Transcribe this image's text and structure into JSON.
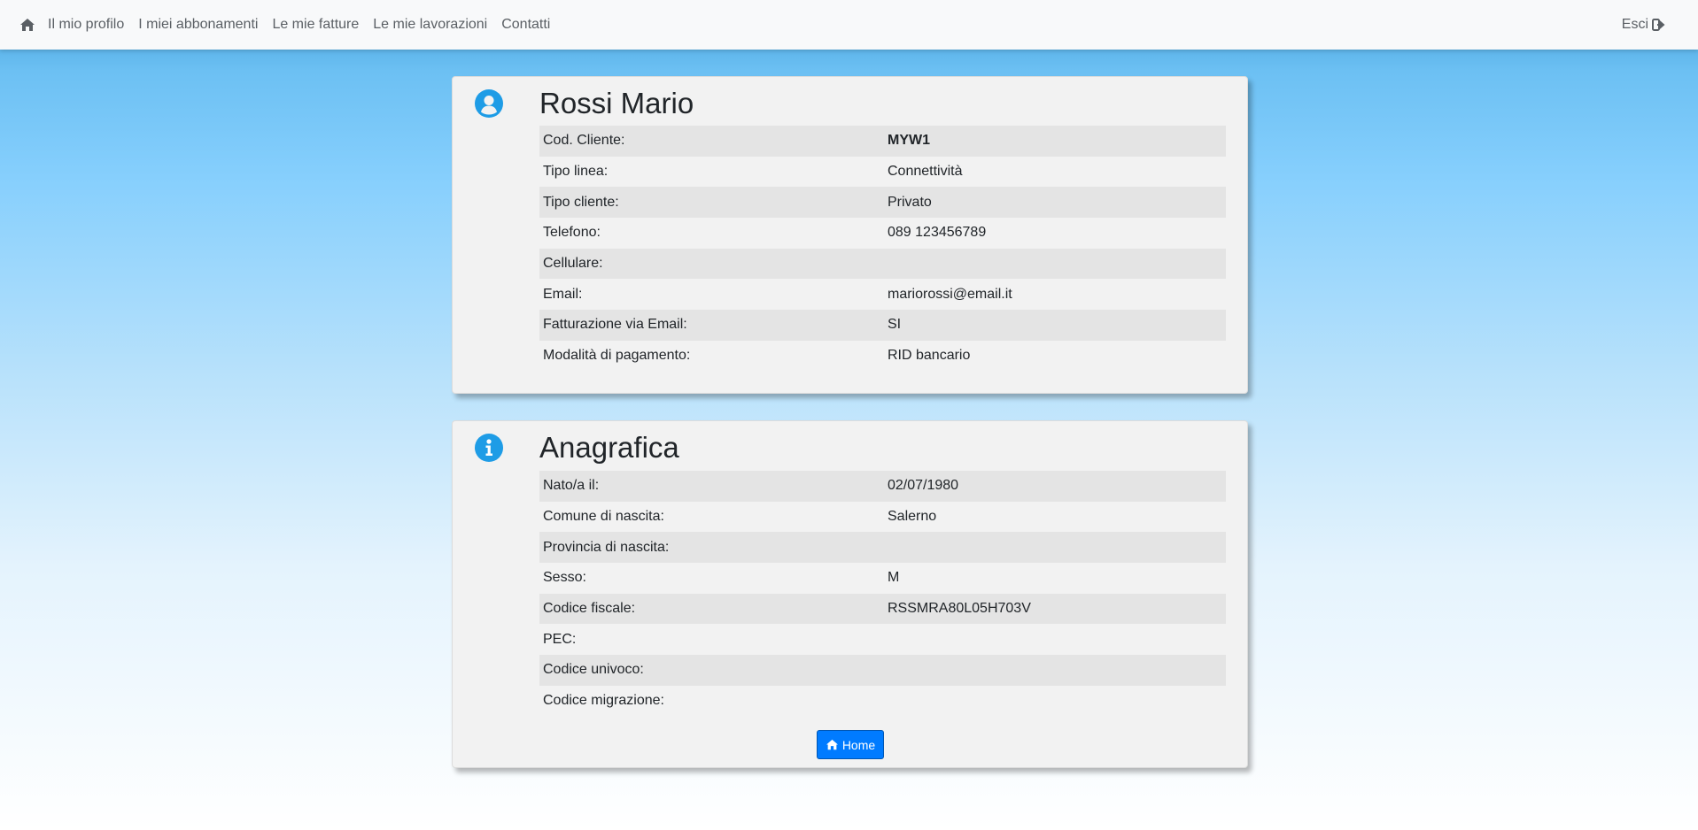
{
  "nav": {
    "home_icon": "home-icon",
    "links": [
      "Il mio profilo",
      "I miei abbonamenti",
      "Le mie fatture",
      "Le mie lavorazioni",
      "Contatti"
    ],
    "logout_label": "Esci",
    "logout_icon": "sign-out-icon"
  },
  "profile": {
    "icon": "user-circle-icon",
    "title": "Rossi Mario",
    "rows": [
      {
        "label": "Cod. Cliente:",
        "value": "MYW1"
      },
      {
        "label": "Tipo linea:",
        "value": "Connettività"
      },
      {
        "label": "Tipo cliente:",
        "value": "Privato"
      },
      {
        "label": "Telefono:",
        "value": "089 123456789"
      },
      {
        "label": "Cellulare:",
        "value": ""
      },
      {
        "label": "Email:",
        "value": "mariorossi@email.it"
      },
      {
        "label": "Fatturazione via Email:",
        "value": "SI"
      },
      {
        "label": "Modalità di pagamento:",
        "value": "RID bancario"
      }
    ]
  },
  "anagrafica": {
    "icon": "info-circle-icon",
    "title": "Anagrafica",
    "rows": [
      {
        "label": "Nato/a il:",
        "value": "02/07/1980"
      },
      {
        "label": "Comune di nascita:",
        "value": "Salerno"
      },
      {
        "label": "Provincia di nascita:",
        "value": ""
      },
      {
        "label": "Sesso:",
        "value": "M"
      },
      {
        "label": "Codice fiscale:",
        "value": "RSSMRA80L05H703V"
      },
      {
        "label": "PEC:",
        "value": ""
      },
      {
        "label": "Codice univoco:",
        "value": ""
      },
      {
        "label": "Codice migrazione:",
        "value": ""
      }
    ],
    "home_button_label": "Home"
  },
  "colors": {
    "accent": "#1e9ce6",
    "button": "#007bff"
  }
}
